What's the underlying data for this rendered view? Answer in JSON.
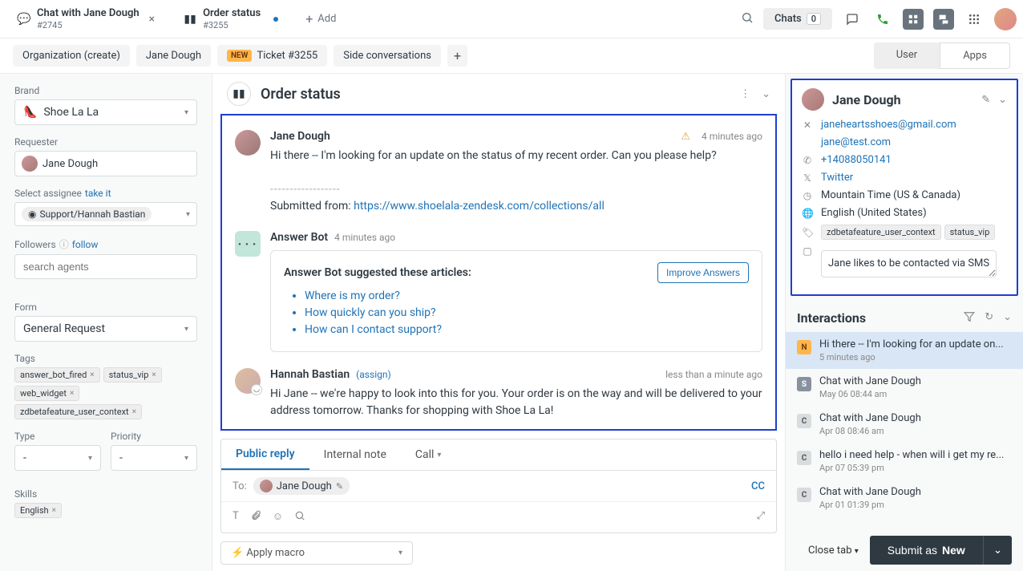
{
  "top_tabs": {
    "tab1_title": "Chat with Jane Dough",
    "tab1_sub": "#2745",
    "tab2_title": "Order status",
    "tab2_sub": "#3255",
    "add_label": "Add"
  },
  "top_right": {
    "chats_label": "Chats",
    "chats_count": "0"
  },
  "secondary_nav": {
    "org": "Organization (create)",
    "user": "Jane Dough",
    "ticket_new": "NEW",
    "ticket": "Ticket #3255",
    "side": "Side conversations",
    "right_user": "User",
    "right_apps": "Apps"
  },
  "sidebar": {
    "brand_label": "Brand",
    "brand_value": "Shoe La La",
    "requester_label": "Requester",
    "requester_value": "Jane Dough",
    "assignee_label": "Select assignee",
    "take_it": "take it",
    "assignee_value": "Support/Hannah Bastian",
    "followers_label": "Followers",
    "follow": "follow",
    "followers_placeholder": "search agents",
    "form_label": "Form",
    "form_value": "General Request",
    "tags_label": "Tags",
    "tags": [
      "answer_bot_fired",
      "status_vip",
      "web_widget",
      "zdbetafeature_user_context"
    ],
    "type_label": "Type",
    "type_value": "-",
    "priority_label": "Priority",
    "priority_value": "-",
    "skills_label": "Skills",
    "skills_value": "English"
  },
  "conversation": {
    "title": "Order status",
    "msg1_author": "Jane Dough",
    "msg1_time": "4 minutes ago",
    "msg1_text": "Hi there -- I'm looking for an update on the status of my recent order. Can you please help?",
    "msg1_divider": "------------------",
    "msg1_submitted_prefix": "Submitted from: ",
    "msg1_submitted_link": "https://www.shoelala-zendesk.com/collections/all",
    "bot_author": "Answer Bot",
    "bot_time": "4 minutes ago",
    "suggest_heading": "Answer Bot suggested these articles:",
    "improve_btn": "Improve Answers",
    "articles": [
      "Where is my order?",
      "How quickly can you ship?",
      "How can I contact support?"
    ],
    "msg2_author": "Hannah Bastian",
    "msg2_assign": "(assign)",
    "msg2_time": "less than a minute ago",
    "msg2_text": "Hi Jane -- we're happy to look into this for you. Your order is on the way and will be delivered to your address tomorrow. Thanks for shopping with Shoe La La!"
  },
  "reply": {
    "tab_public": "Public reply",
    "tab_internal": "Internal note",
    "tab_call": "Call",
    "to_label": "To:",
    "to_value": "Jane Dough",
    "cc": "CC",
    "macro": "Apply macro"
  },
  "profile": {
    "name": "Jane Dough",
    "email1": "janeheartsshoes@gmail.com",
    "email2": "jane@test.com",
    "phone": "+14088050141",
    "twitter": "Twitter",
    "tz": "Mountain Time (US & Canada)",
    "lang": "English (United States)",
    "tags": [
      "zdbetafeature_user_context",
      "status_vip"
    ],
    "note": "Jane likes to be contacted via SMS"
  },
  "interactions": {
    "title": "Interactions",
    "items": [
      {
        "badge": "N",
        "badgeClass": "n",
        "title": "Hi there -- I'm looking for an update on...",
        "time": "5 minutes ago"
      },
      {
        "badge": "S",
        "badgeClass": "s",
        "title": "Chat with Jane Dough",
        "time": "May 06 08:44 am"
      },
      {
        "badge": "C",
        "badgeClass": "c",
        "title": "Chat with Jane Dough",
        "time": "Apr 08 08:46 am"
      },
      {
        "badge": "C",
        "badgeClass": "c",
        "title": "hello i need help - when will i get my re...",
        "time": "Apr 07 05:39 pm"
      },
      {
        "badge": "C",
        "badgeClass": "c",
        "title": "Chat with Jane Dough",
        "time": "Apr 01 01:39 pm"
      }
    ]
  },
  "footer": {
    "close": "Close tab",
    "submit_prefix": "Submit as ",
    "submit_status": "New"
  }
}
